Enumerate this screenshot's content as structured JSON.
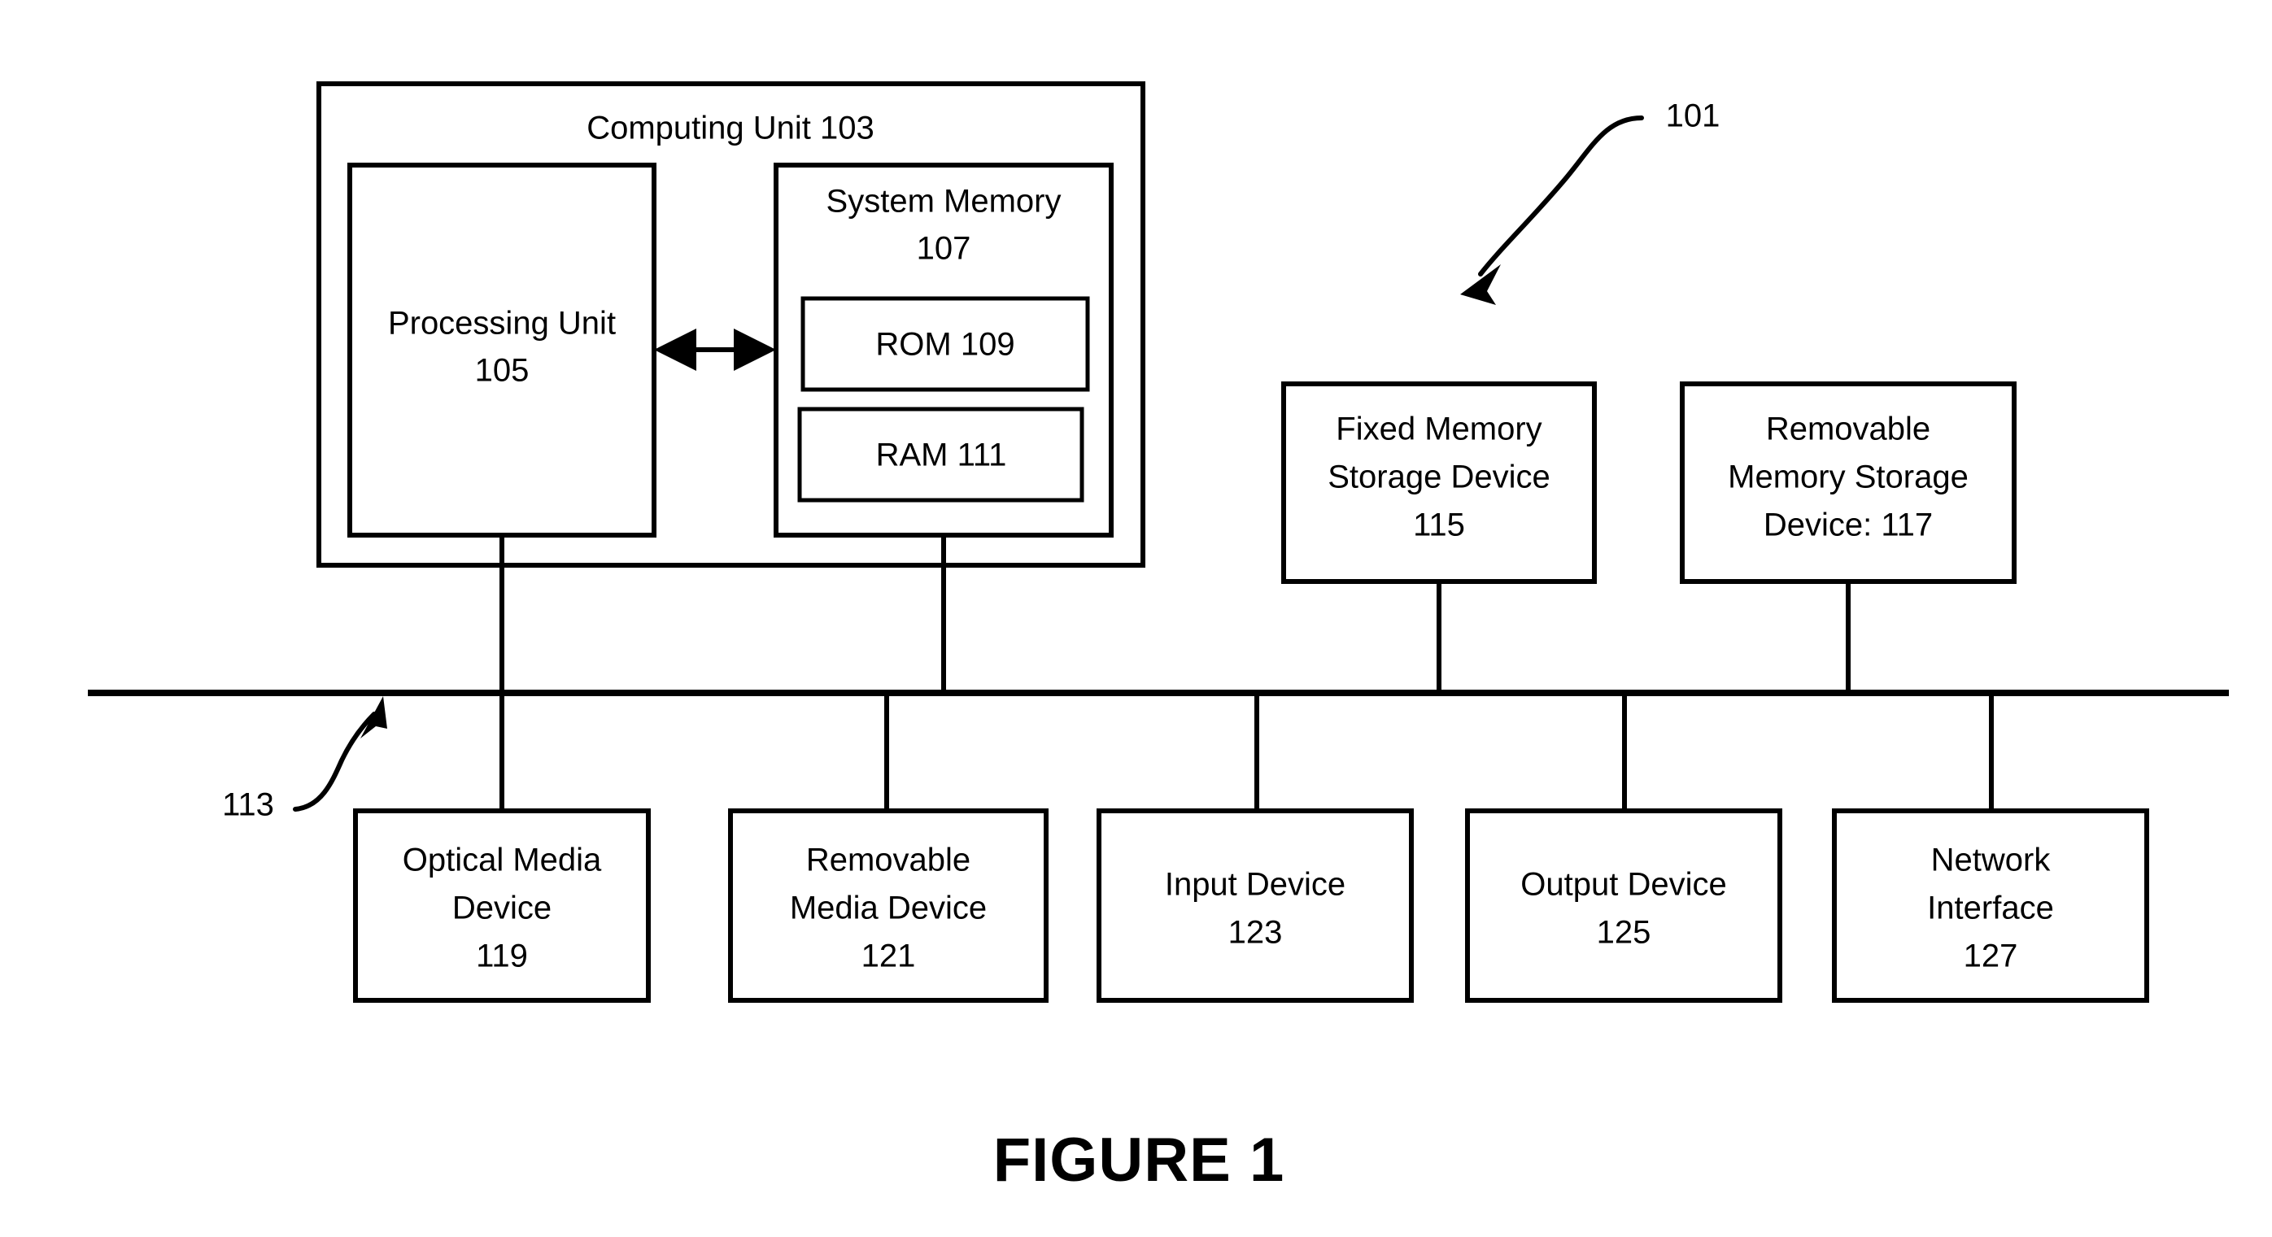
{
  "figure": {
    "caption": "FIGURE 1",
    "system_ref": "101",
    "bus_ref": "113"
  },
  "computing_unit": {
    "title": "Computing Unit 103",
    "processing_unit": {
      "line1": "Processing Unit",
      "line2": "105"
    },
    "system_memory": {
      "line1": "System Memory",
      "line2": "107",
      "rom": "ROM 109",
      "ram": "RAM 111"
    }
  },
  "storage_devices": [
    {
      "name": "fixed-memory-storage-device",
      "line1": "Fixed Memory",
      "line2": "Storage Device",
      "line3": "115"
    },
    {
      "name": "removable-memory-storage-device",
      "line1": "Removable",
      "line2": "Memory Storage",
      "line3": "Device: 117"
    }
  ],
  "peripherals": [
    {
      "name": "optical-media-device",
      "line1": "Optical Media",
      "line2": "Device",
      "line3": "119"
    },
    {
      "name": "removable-media-device",
      "line1": "Removable",
      "line2": "Media Device",
      "line3": "121"
    },
    {
      "name": "input-device",
      "line1": "Input Device",
      "line2": "123",
      "line3": ""
    },
    {
      "name": "output-device",
      "line1": "Output Device",
      "line2": "125",
      "line3": ""
    },
    {
      "name": "network-interface",
      "line1": "Network",
      "line2": "Interface",
      "line3": "127"
    }
  ],
  "colors": {
    "ink": "#000000",
    "paper": "#ffffff"
  }
}
